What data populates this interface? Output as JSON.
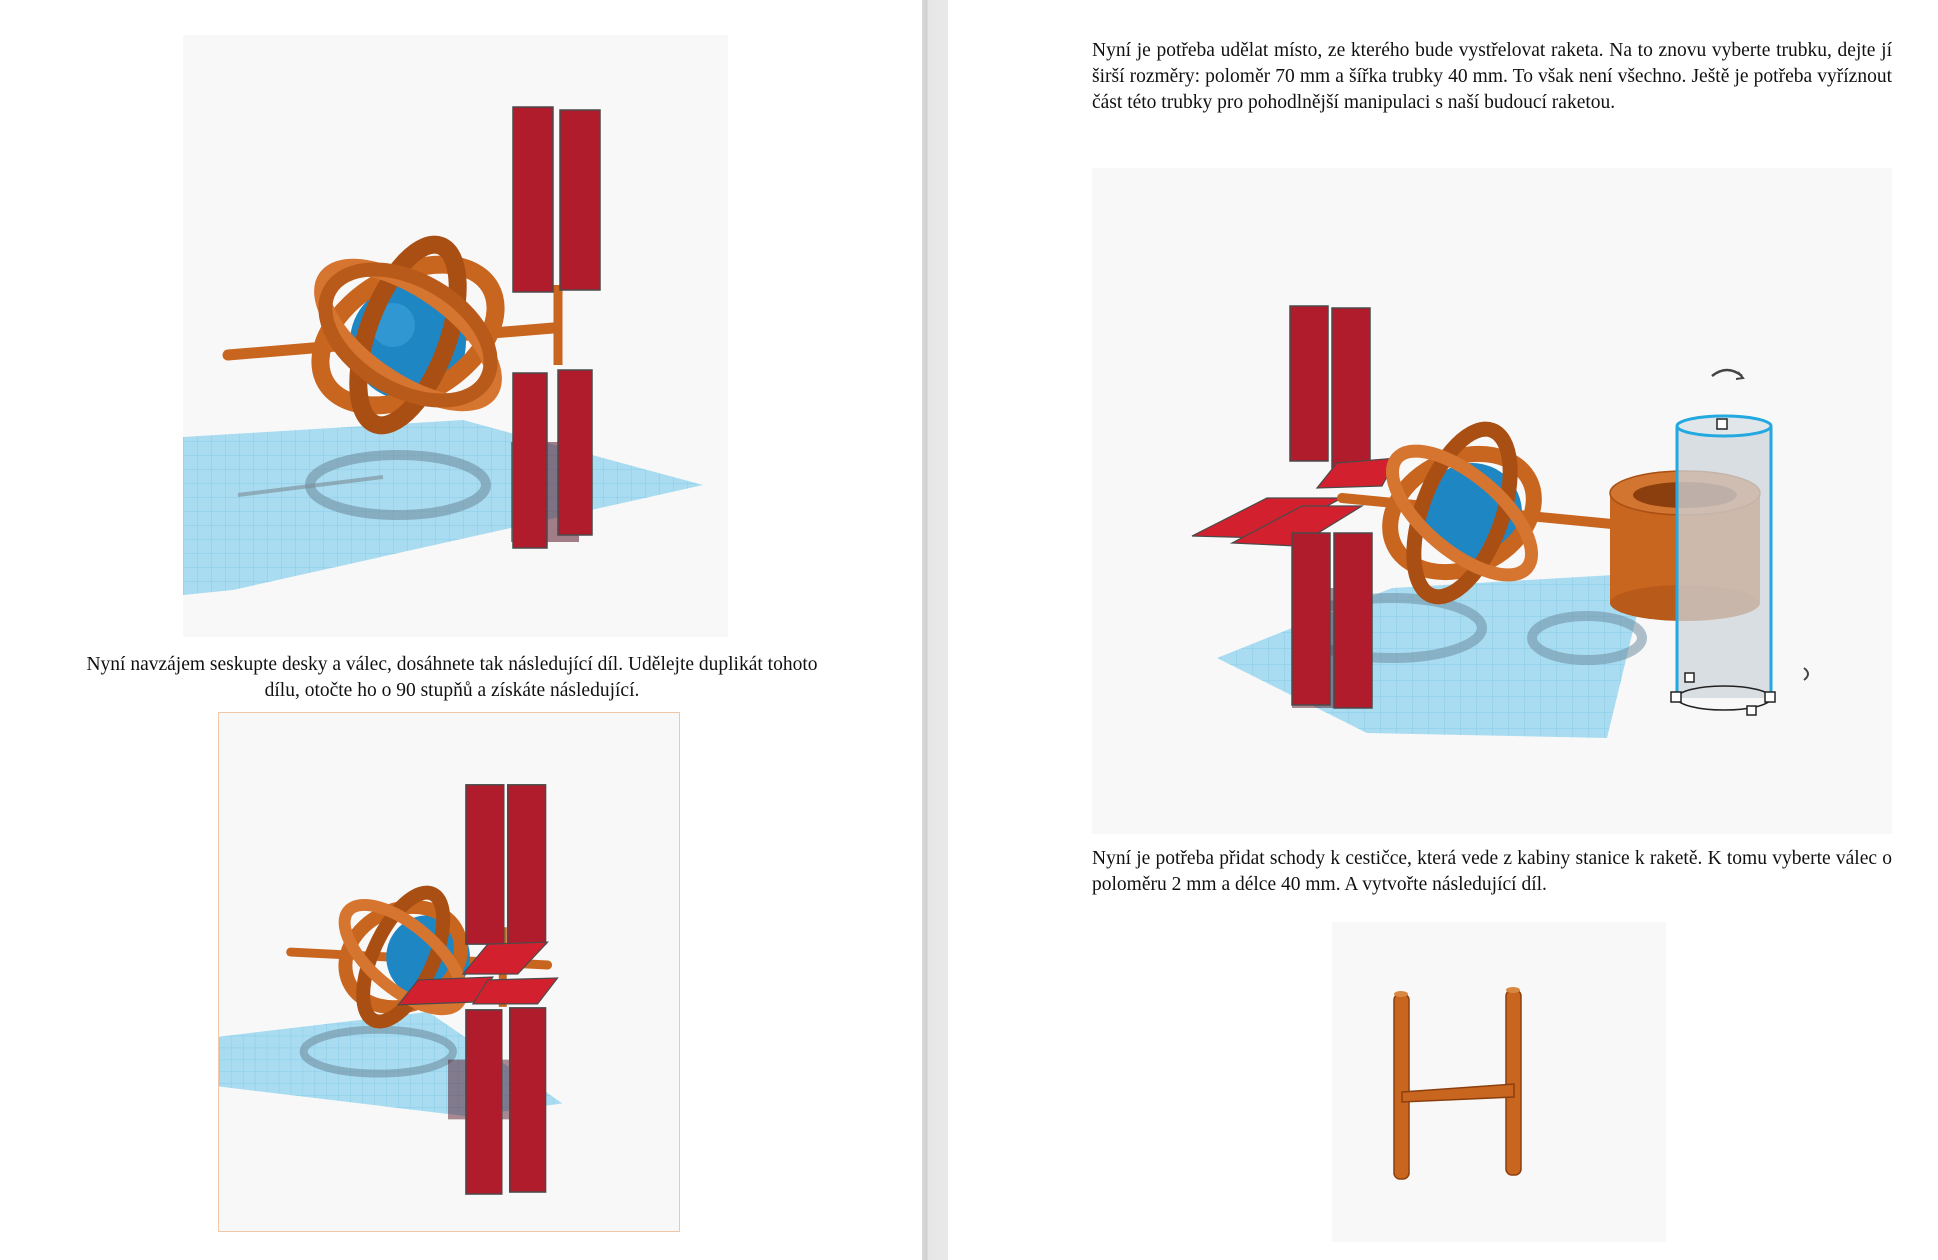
{
  "document": {
    "left_page": {
      "caption_1": "Nyní navzájem seskupte desky a válec, dosáhnete tak následující díl. Udělejte duplikát tohoto dílu, otočte ho o 90 stupňů a získáte následující.",
      "figure_1_icon": "space-station-one-panel-pair-icon",
      "figure_2_icon": "space-station-two-panel-pairs-icon"
    },
    "right_page": {
      "paragraph_1": "Nyní je potřeba udělat místo, ze kterého bude vystřelovat raketa. Na to znovu vyberte trubku, dejte jí širší rozměry: poloměr 70 mm a šířka trubky 40 mm. To však není všechno. Ještě je potřeba vyříznout část této trubky pro pohodlnější manipulaci s naší budoucí raketou.",
      "paragraph_2": "Nyní je potřeba přidat schody k cestičce, která vede z kabiny stanice k raketě. K tomu vyberte válec o poloměru 2 mm a délce 40 mm. A vytvořte následující díl.",
      "figure_3_icon": "station-with-tube-hole-cylinder-icon",
      "figure_4_icon": "h-shaped-stair-part-icon"
    },
    "colors": {
      "orange": "#c8651e",
      "red": "#b01c2c",
      "blue_sphere": "#1f86c4",
      "grid": "#9fd6ef",
      "selection": "#23a8e0"
    }
  }
}
